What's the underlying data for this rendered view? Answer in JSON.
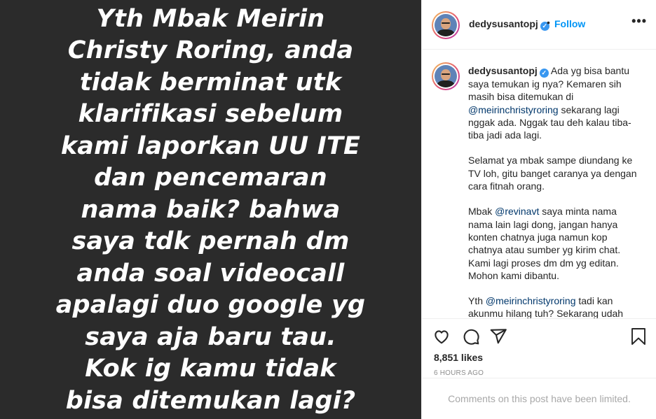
{
  "media": {
    "text_lines": [
      "Yth Mbak Meirin",
      "Christy Roring, anda",
      "tidak berminat utk",
      "klarifikasi sebelum",
      "kami laporkan UU ITE",
      "dan pencemaran",
      "nama baik? bahwa",
      "saya tdk pernah dm",
      "anda soal videocall",
      "apalagi duo google yg",
      "saya aja baru tau.",
      "Kok ig kamu tidak",
      "bisa ditemukan lagi?"
    ],
    "background": "#2b2b2b"
  },
  "header": {
    "username": "dedysusantopj",
    "verified_icon": "verified-badge",
    "separator": "•",
    "follow_label": "Follow",
    "more_label": "•••"
  },
  "caption": {
    "username": "dedysusantopj",
    "p1_a": " Ada yg bisa bantu saya temukan ig nya? Kemaren sih masih bisa ditemukan di ",
    "p1_mention": "@meirinchristyroring",
    "p1_b": " sekarang lagi nggak ada. Nggak tau deh kalau tiba-tiba jadi ada lagi.",
    "p2": "Selamat ya mbak sampe diundang ke TV loh, gitu banget caranya ya dengan cara fitnah orang.",
    "p3_a": "Mbak ",
    "p3_mention": "@revinavt",
    "p3_b": " saya minta nama nama lain lagi dong, jangan hanya konten chatnya juga namun kop chatnya atau sumber yg kirim chat. Kami lagi proses dm dm yg editan. Mohon kami dibantu.",
    "p4_a": "Yth ",
    "p4_mention": "@meirinchristyroring",
    "p4_b": " tadi kan akunmu hilang tuh? Sekarang udah"
  },
  "actions": {
    "icons": [
      "heart-icon",
      "comment-icon",
      "share-icon",
      "bookmark-icon"
    ],
    "likes": "8,851 likes",
    "timestamp": "6 HOURS AGO"
  },
  "footer": {
    "comments_limited": "Comments on this post have been limited."
  },
  "colors": {
    "link_blue": "#0095f6",
    "mention": "#00376b",
    "muted": "#8e8e8e"
  }
}
